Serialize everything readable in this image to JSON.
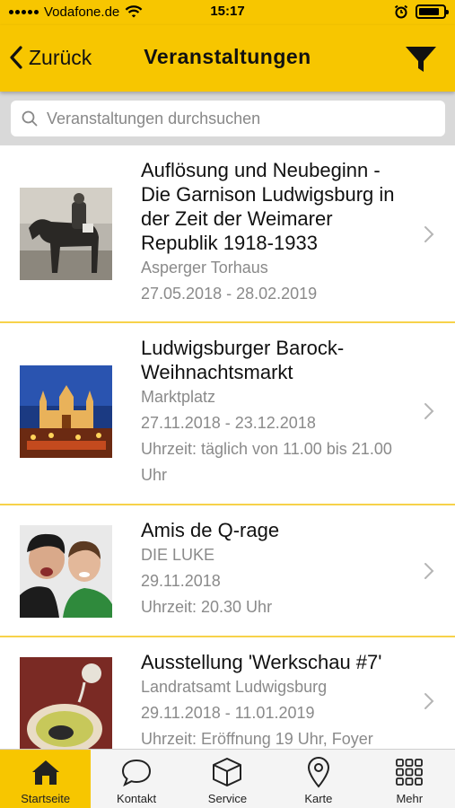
{
  "status": {
    "carrier": "Vodafone.de",
    "time": "15:17",
    "battery_level": 0.85
  },
  "nav": {
    "back_label": "Zurück",
    "title": "Veranstaltungen",
    "filter_icon": "filter-icon"
  },
  "search": {
    "placeholder": "Veranstaltungen durchsuchen",
    "value": ""
  },
  "events": [
    {
      "title": "Auflösung und Neubeginn - Die Garnison Ludwigsburg in der Zeit der Weimarer Republik 1918-1933",
      "location": "Asperger Torhaus",
      "date": "27.05.2018 - 28.02.2019",
      "time": ""
    },
    {
      "title": "Ludwigsburger Barock-Weihnachtsmarkt",
      "location": "Marktplatz",
      "date": "27.11.2018 - 23.12.2018",
      "time": "Uhrzeit: täglich von 11.00 bis 21.00 Uhr"
    },
    {
      "title": "Amis de Q-rage",
      "location": "DIE LUKE",
      "date": "29.11.2018",
      "time": "Uhrzeit: 20.30 Uhr"
    },
    {
      "title": "Ausstellung 'Werkschau #7'",
      "location": "Landratsamt Ludwigsburg",
      "date": "29.11.2018 - 11.01.2019",
      "time": "Uhrzeit: Eröffnung 19 Uhr, Foyer"
    }
  ],
  "tabs": [
    {
      "label": "Startseite",
      "icon": "home-icon",
      "active": true
    },
    {
      "label": "Kontakt",
      "icon": "chat-bubble-icon",
      "active": false
    },
    {
      "label": "Service",
      "icon": "box-icon",
      "active": false
    },
    {
      "label": "Karte",
      "icon": "map-pin-icon",
      "active": false
    },
    {
      "label": "Mehr",
      "icon": "grid-icon",
      "active": false
    }
  ],
  "colors": {
    "accent": "#f7c600",
    "divider": "#f7d24a",
    "meta_text": "#8a8a8a"
  }
}
